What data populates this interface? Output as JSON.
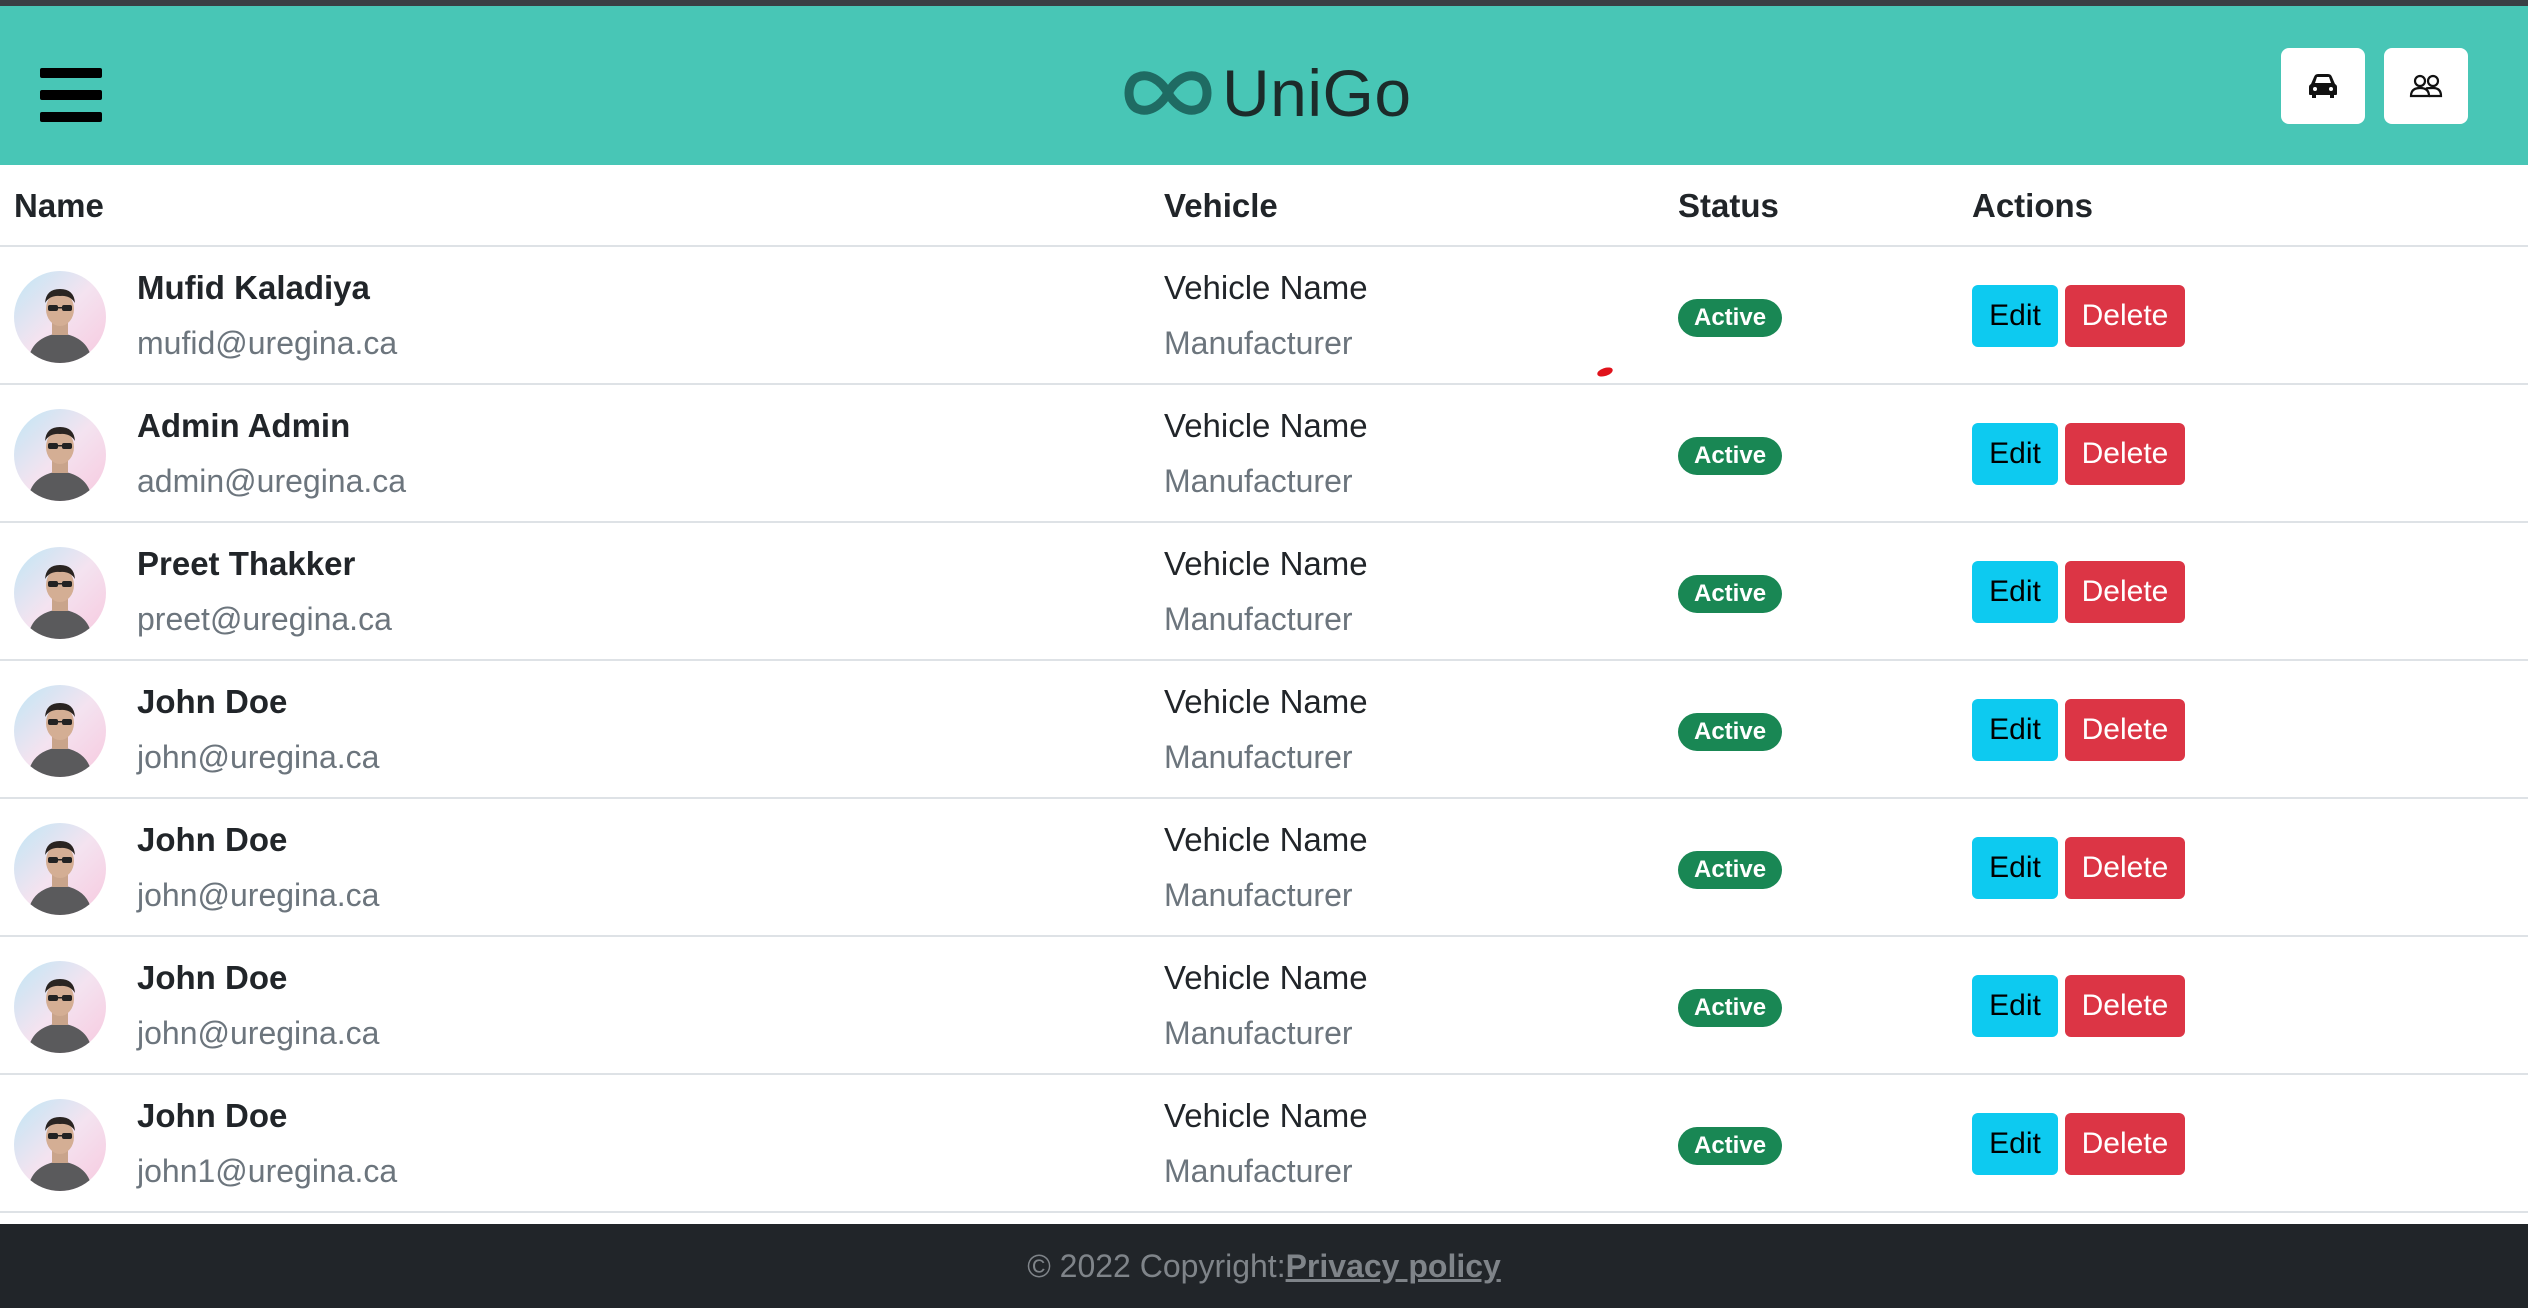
{
  "app": {
    "brand": "UniGo"
  },
  "header": {
    "menu_icon": "hamburger-menu-icon",
    "buttons": [
      {
        "icon": "car-icon"
      },
      {
        "icon": "users-icon"
      }
    ],
    "colors": {
      "navbar_bg": "#48c6b6"
    }
  },
  "table": {
    "columns": [
      "Name",
      "Vehicle",
      "Status",
      "Actions"
    ],
    "rows": [
      {
        "name": "Mufid Kaladiya",
        "email": "mufid@uregina.ca",
        "vehicle_name": "Vehicle Name",
        "manufacturer": "Manufacturer",
        "status": "Active",
        "edit_label": "Edit",
        "delete_label": "Delete"
      },
      {
        "name": "Admin Admin",
        "email": "admin@uregina.ca",
        "vehicle_name": "Vehicle Name",
        "manufacturer": "Manufacturer",
        "status": "Active",
        "edit_label": "Edit",
        "delete_label": "Delete"
      },
      {
        "name": "Preet Thakker",
        "email": "preet@uregina.ca",
        "vehicle_name": "Vehicle Name",
        "manufacturer": "Manufacturer",
        "status": "Active",
        "edit_label": "Edit",
        "delete_label": "Delete"
      },
      {
        "name": "John Doe",
        "email": "john@uregina.ca",
        "vehicle_name": "Vehicle Name",
        "manufacturer": "Manufacturer",
        "status": "Active",
        "edit_label": "Edit",
        "delete_label": "Delete"
      },
      {
        "name": "John Doe",
        "email": "john@uregina.ca",
        "vehicle_name": "Vehicle Name",
        "manufacturer": "Manufacturer",
        "status": "Active",
        "edit_label": "Edit",
        "delete_label": "Delete"
      },
      {
        "name": "John Doe",
        "email": "john@uregina.ca",
        "vehicle_name": "Vehicle Name",
        "manufacturer": "Manufacturer",
        "status": "Active",
        "edit_label": "Edit",
        "delete_label": "Delete"
      },
      {
        "name": "John Doe",
        "email": "john1@uregina.ca",
        "vehicle_name": "Vehicle Name",
        "manufacturer": "Manufacturer",
        "status": "Active",
        "edit_label": "Edit",
        "delete_label": "Delete"
      }
    ],
    "colors": {
      "active_badge": "#198754",
      "edit_button": "#0dcaf0",
      "delete_button": "#dc3545"
    }
  },
  "footer": {
    "copyright": "© 2022 Copyright:",
    "link_label": "Privacy policy",
    "colors": {
      "bg": "#212529"
    }
  }
}
